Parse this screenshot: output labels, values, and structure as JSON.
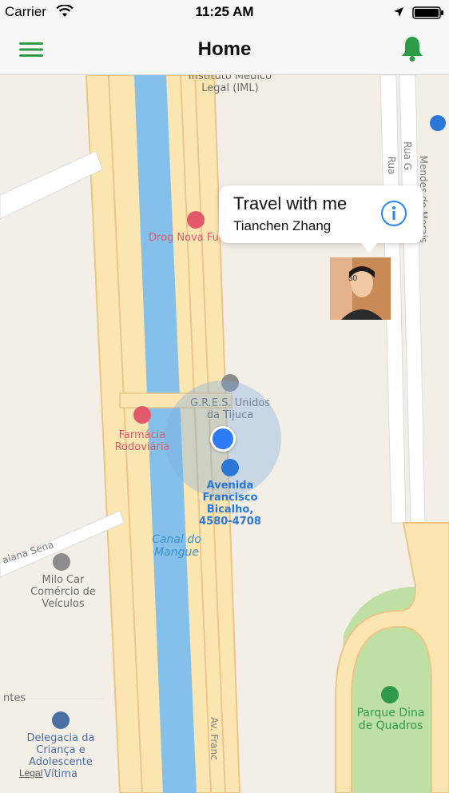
{
  "status_bar": {
    "carrier": "Carrier",
    "time": "11:25 AM",
    "icons": [
      "wifi-icon",
      "location-arrow-icon",
      "battery-icon"
    ]
  },
  "navbar": {
    "title": "Home",
    "left_icon": "menu-icon",
    "right_icon": "bell-icon",
    "accent_color": "#2e9b47"
  },
  "map": {
    "callout": {
      "title": "Travel with me",
      "subtitle": "Tianchen Zhang",
      "info_icon": "info-icon"
    },
    "avatar_badge": "50",
    "labels": {
      "instituto": "Instituto Médico\nLegal (IML)",
      "drog": "Drog Nova Fu",
      "gres": "G.R.E.S. Unidos\nda Tijuca",
      "farmacia": "Farmácia\nRodoviária",
      "avenida": "Avenida\nFrancisco\nBicalho,\n4580-4708",
      "canal": "Canal do\nMangue",
      "milo": "Milo Car\nComércio de\nVeículos",
      "delegacia": "Delegacia da\nCriança e\nAdolescente\nVítima",
      "parque": "Parque Dina\nde Quadros",
      "street_rua_sena": "aiana Sena",
      "street_mendes": "Mendes de Morais",
      "street_rua_g": "Rua G",
      "street_rua": "Rua",
      "street_av_franc": "Av. Franc",
      "street_ntes": "ntes"
    },
    "legal": "Legal",
    "colors": {
      "land": "#f3efe7",
      "road": "#fbe6b2",
      "road_edge": "#eec487",
      "water": "#84c0e9",
      "park": "#bfe0a5",
      "user_dot": "#2d7cf6"
    }
  }
}
